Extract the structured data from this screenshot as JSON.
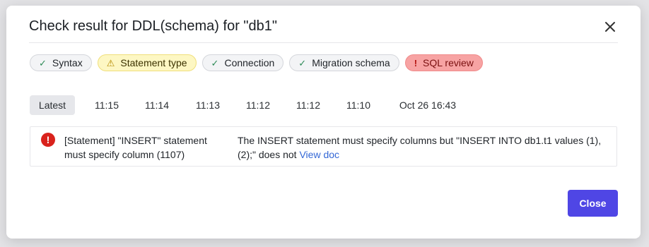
{
  "dialog": {
    "title": "Check result for DDL(schema) for \"db1\"",
    "close_icon": "close-icon"
  },
  "checks": [
    {
      "label": "Syntax",
      "status": "success",
      "icon": "check-icon"
    },
    {
      "label": "Statement type",
      "status": "warning",
      "icon": "warning-triangle-icon"
    },
    {
      "label": "Connection",
      "status": "success",
      "icon": "check-icon"
    },
    {
      "label": "Migration schema",
      "status": "success",
      "icon": "check-icon"
    },
    {
      "label": "SQL review",
      "status": "error",
      "icon": "exclamation-icon"
    }
  ],
  "timeline": [
    {
      "label": "Latest",
      "active": true
    },
    {
      "label": "11:15"
    },
    {
      "label": "11:14"
    },
    {
      "label": "11:13"
    },
    {
      "label": "11:12"
    },
    {
      "label": "11:12"
    },
    {
      "label": "11:10"
    },
    {
      "label": "Oct 26 16:43"
    }
  ],
  "result": {
    "icon": "error-circle-icon",
    "title": "[Statement] \"INSERT\" statement must specify column (1107)",
    "description": "The INSERT statement must specify columns but \"INSERT INTO db1.t1 values (1), (2);\" does not",
    "link_label": "View doc"
  },
  "footer": {
    "close_label": "Close"
  },
  "colors": {
    "primary": "#4f46e5",
    "error": "#d9221c",
    "success": "#2e8b57",
    "warning_bg": "#fdf7c3",
    "error_bg": "#f7a3a3"
  }
}
